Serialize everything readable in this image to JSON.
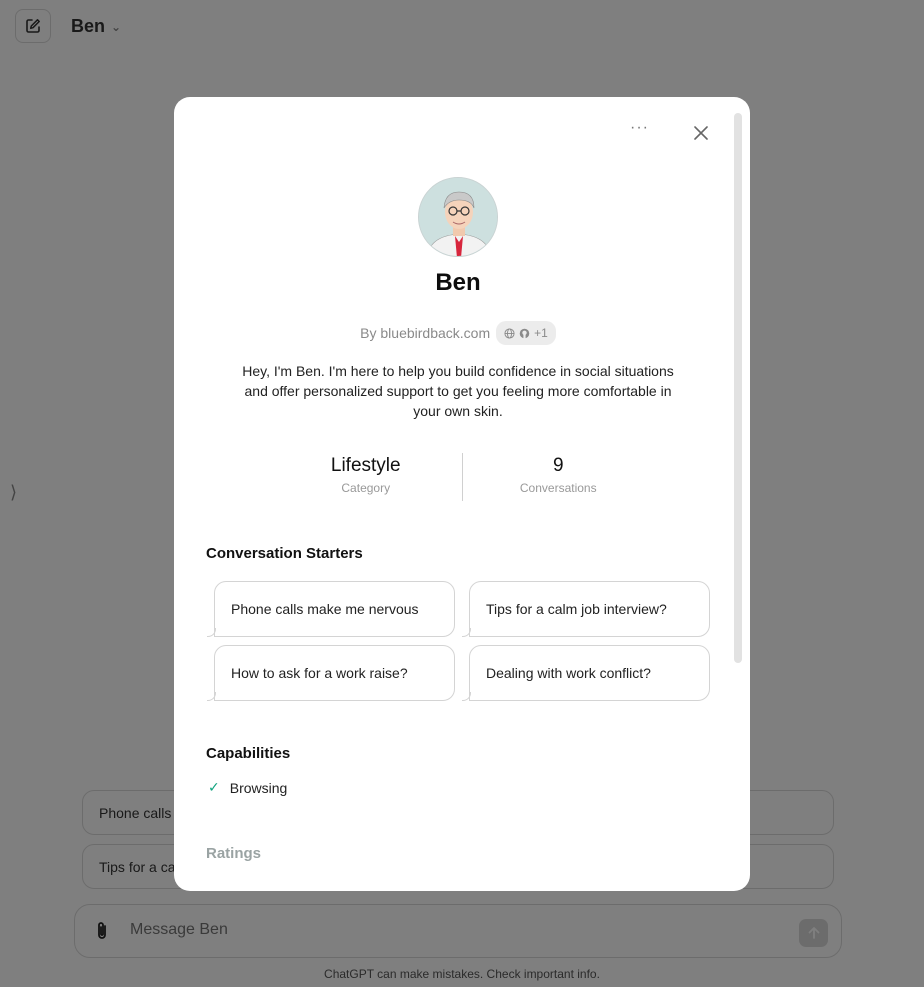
{
  "header": {
    "model_name": "Ben"
  },
  "background": {
    "starters": [
      "Phone calls",
      "Tips for a ca"
    ],
    "composer_placeholder": "Message Ben",
    "disclaimer": "ChatGPT can make mistakes. Check important info."
  },
  "modal": {
    "name": "Ben",
    "byline": "By bluebirdback.com",
    "pill_extra": "+1",
    "description": "Hey, I'm Ben. I'm here to help you build confidence in social situations and offer personalized support to get you feeling more comfortable in your own skin.",
    "stats": [
      {
        "value": "Lifestyle",
        "label": "Category"
      },
      {
        "value": "9",
        "label": "Conversations"
      }
    ],
    "starters_title": "Conversation Starters",
    "starters": [
      "Phone calls make me nervous",
      "Tips for a calm job interview?",
      "How to ask for a work raise?",
      "Dealing with work conflict?"
    ],
    "capabilities_title": "Capabilities",
    "capabilities": [
      "Browsing"
    ],
    "ratings_title": "Ratings",
    "more_label": "···"
  },
  "colors": {
    "accent_check": "#10a37f",
    "overlay": "rgba(0,0,0,0.5)"
  },
  "icons": [
    "new-chat-icon",
    "chevron-down-icon",
    "paperclip-icon",
    "arrow-up-icon",
    "globe-icon",
    "github-icon",
    "close-icon",
    "check-icon"
  ]
}
